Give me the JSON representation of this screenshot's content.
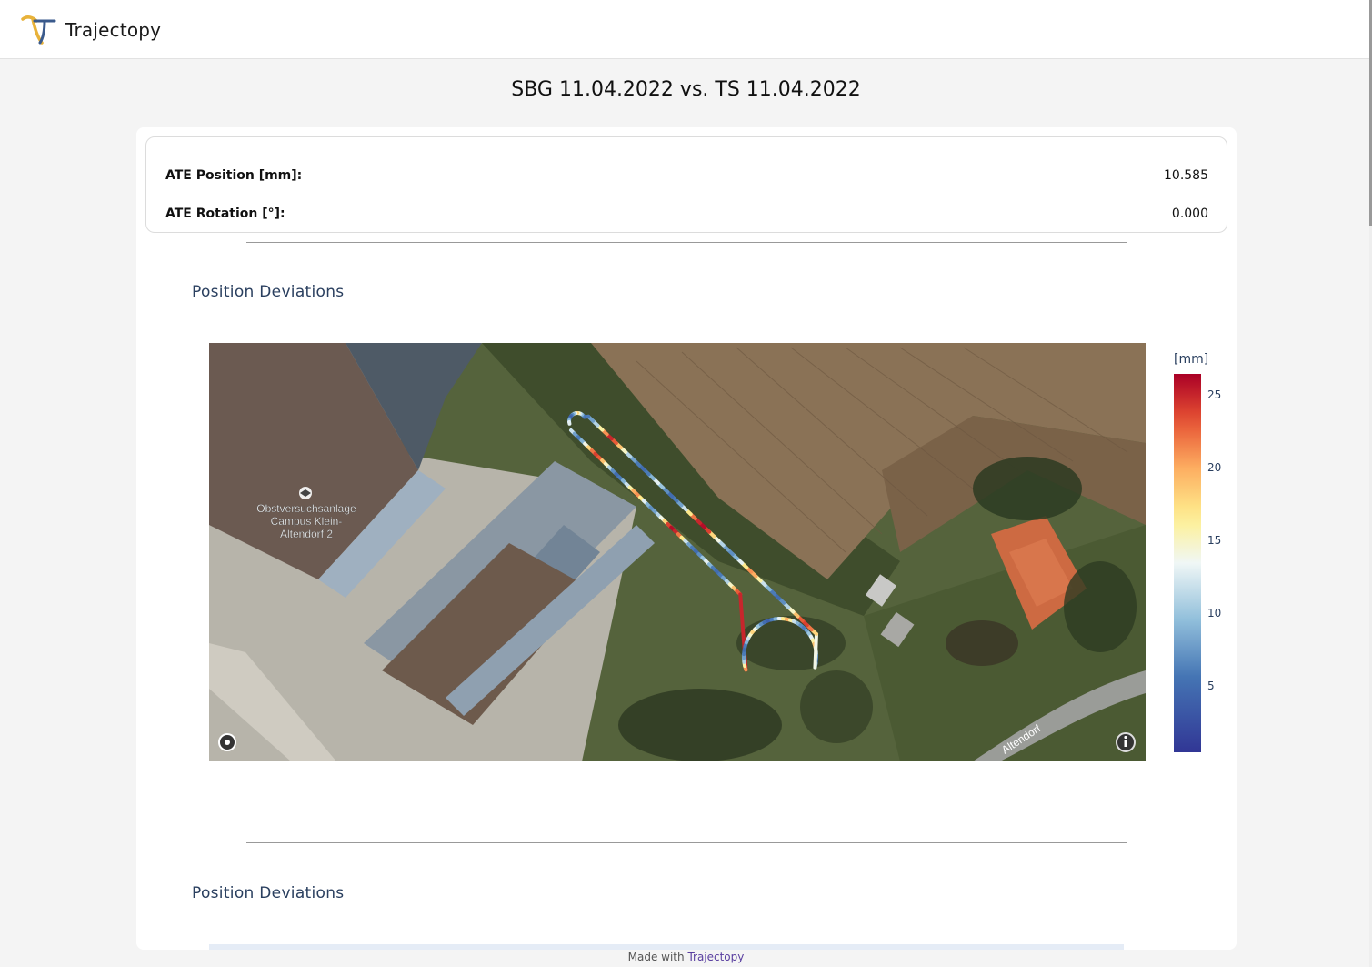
{
  "app": {
    "name": "Trajectopy"
  },
  "page": {
    "title": "SBG 11.04.2022 vs. TS 11.04.2022"
  },
  "metrics": [
    {
      "label": "ATE Position [mm]:",
      "value": "10.585"
    },
    {
      "label": "ATE Rotation [°]:",
      "value": "0.000"
    }
  ],
  "sections": [
    {
      "title": "Position Deviations"
    },
    {
      "title": "Position Deviations"
    }
  ],
  "map": {
    "place_label_lines": [
      "Obstversuchsanlage",
      "Campus Klein-",
      "Altendorf 2"
    ],
    "street_label": "Altendorf",
    "place_icon": "graduation-cap-icon",
    "attribution_icon": "info-icon"
  },
  "chart_data": {
    "type": "scatter",
    "title": "",
    "colorbar": {
      "title": "[mm]",
      "ticks": [
        5,
        10,
        15,
        20,
        25
      ],
      "range": [
        0.5,
        26.5
      ],
      "colorscale": "RdYlBu_r",
      "colors": {
        "low": "#2c3a9a",
        "mid": "#f5f7f0",
        "high": "#c00d25"
      }
    },
    "deviation_mm": [
      12,
      8,
      6,
      9,
      14,
      18,
      22,
      24,
      23,
      19,
      15,
      11,
      7,
      5,
      6,
      9,
      12,
      16,
      20,
      21,
      17,
      13,
      9,
      7,
      8,
      11,
      14,
      18,
      24,
      26,
      25,
      22,
      17,
      12,
      8,
      6,
      5,
      7,
      10,
      13,
      9,
      6,
      5,
      6,
      8,
      11,
      15,
      19,
      23,
      25,
      21,
      16,
      11,
      8,
      6,
      5,
      6,
      9,
      12,
      15,
      18,
      14,
      10,
      7,
      5,
      4,
      6,
      9,
      13,
      17,
      20,
      16,
      12,
      9,
      7,
      6,
      8,
      10,
      13,
      16,
      19,
      15
    ]
  },
  "footer": {
    "prefix": "Made with",
    "link": "Trajectopy"
  }
}
